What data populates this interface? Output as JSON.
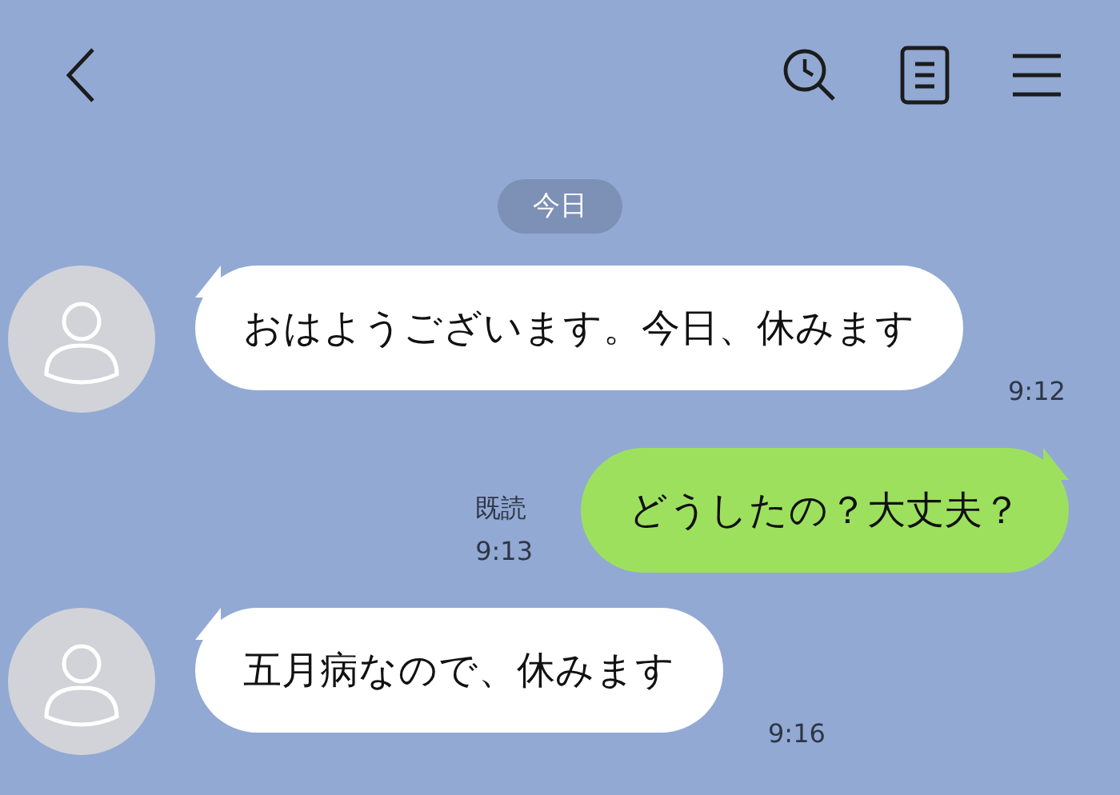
{
  "date_separator": "今日",
  "messages": [
    {
      "kind": "incoming",
      "text": "おはようございます。今日、休みます",
      "time": "9:12"
    },
    {
      "kind": "outgoing",
      "text": "どうしたの？大丈夫？",
      "time": "9:13",
      "read_label": "既読"
    },
    {
      "kind": "incoming",
      "text": "五月病なので、休みます",
      "time": "9:16"
    }
  ]
}
